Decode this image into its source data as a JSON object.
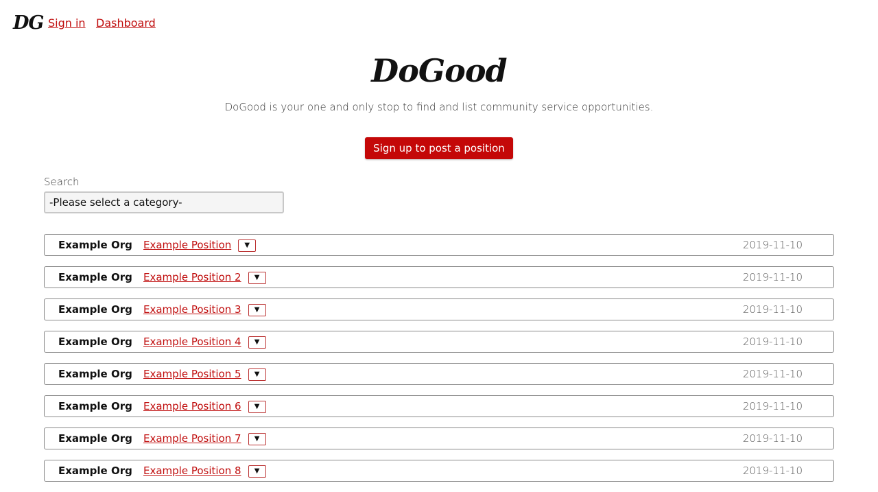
{
  "nav": {
    "logo": "DG",
    "links": [
      "Sign in",
      "Dashboard"
    ]
  },
  "hero": {
    "title": "DoGood",
    "subtitle": "DoGood is your one and only stop to find and list community service opportunities.",
    "cta_label": "Sign up to post a position"
  },
  "search": {
    "label": "Search",
    "selected": "-Please select a category-"
  },
  "colors": {
    "accent": "#c40808",
    "link": "#c00d0d"
  },
  "toggle_icon": "▼",
  "positions": [
    {
      "org": "Example Org",
      "title": "Example Position",
      "date": "2019-11-10"
    },
    {
      "org": "Example Org",
      "title": "Example Position 2",
      "date": "2019-11-10"
    },
    {
      "org": "Example Org",
      "title": "Example Position 3",
      "date": "2019-11-10"
    },
    {
      "org": "Example Org",
      "title": "Example Position 4",
      "date": "2019-11-10"
    },
    {
      "org": "Example Org",
      "title": "Example Position 5",
      "date": "2019-11-10"
    },
    {
      "org": "Example Org",
      "title": "Example Position 6",
      "date": "2019-11-10"
    },
    {
      "org": "Example Org",
      "title": "Example Position 7",
      "date": "2019-11-10"
    },
    {
      "org": "Example Org",
      "title": "Example Position 8",
      "date": "2019-11-10"
    }
  ]
}
